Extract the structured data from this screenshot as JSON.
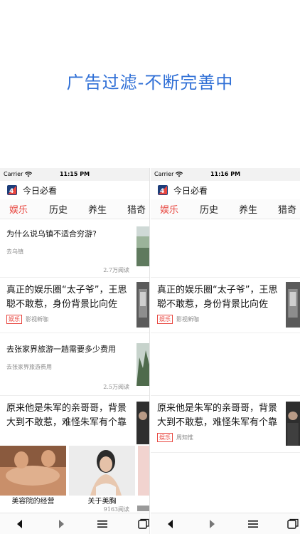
{
  "headline": "广告过滤-不断完善中",
  "colors": {
    "headline": "#2f6fd6",
    "accent": "#e8463f",
    "meta": "#8a8a8a"
  },
  "icons": [
    "wifi-icon",
    "app-logo-icon",
    "back-icon",
    "forward-icon",
    "menu-icon",
    "tabs-icon"
  ],
  "left_phone": {
    "carrier": "Carrier",
    "time": "11:15 PM",
    "app_title": "今日必看",
    "tabs": [
      "娱乐",
      "历史",
      "养生",
      "猎奇"
    ],
    "active_tab": "娱乐",
    "items": [
      {
        "title": "为什么说乌镇不适合穷游?",
        "source": "去乌镇",
        "reads": "2.7万阅读"
      },
      {
        "title": "真正的娱乐圈“太子爷”，王思聪不敢惹，身份背景比向佐",
        "badge": "娱乐",
        "source": "影视新咖"
      },
      {
        "title": "去张家界旅游一趟需要多少费用",
        "source": "去张家界旅游费用",
        "reads": "2.5万阅读"
      },
      {
        "title": "原来他是朱军的亲哥哥，背景大到不敢惹，难怪朱军有个靠"
      }
    ],
    "ad": {
      "cards": [
        "美容院的经营",
        "关于美胸"
      ],
      "reads": "9163阅读"
    }
  },
  "right_phone": {
    "carrier": "Carrier",
    "time": "11:16 PM",
    "app_title": "今日必看",
    "tabs": [
      "娱乐",
      "历史",
      "养生",
      "猎奇"
    ],
    "active_tab": "娱乐",
    "items": [
      {
        "title": "真正的娱乐圈“太子爷”，王思聪不敢惹，身份背景比向佐",
        "badge": "娱乐",
        "source": "影视新咖"
      },
      {
        "title": "原来他是朱军的亲哥哥，背景大到不敢惹，难怪朱军有个靠",
        "badge": "娱乐",
        "source": "周知惟"
      }
    ]
  }
}
